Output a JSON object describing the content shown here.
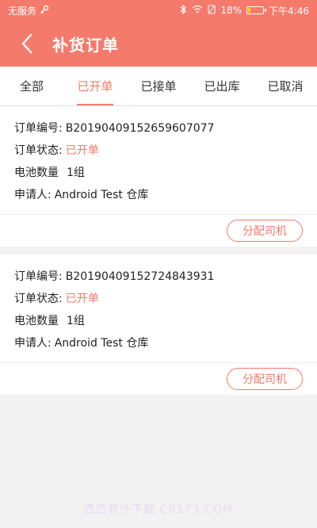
{
  "statusbar": {
    "carrier": "无服务",
    "battery_text": "18%",
    "battery_level": 0.18,
    "time": "下午4:46"
  },
  "header": {
    "title": "补货订单"
  },
  "tabs": [
    {
      "label": "全部"
    },
    {
      "label": "已开单"
    },
    {
      "label": "已接单"
    },
    {
      "label": "已出库"
    },
    {
      "label": "已取消"
    }
  ],
  "orders": [
    {
      "order_no_label": "订单编号:",
      "order_no": "B20190409152659607077",
      "status_label": "订单状态:",
      "status": "已开单",
      "qty_label": "电池数量",
      "qty": "1组",
      "applicant_label": "申请人:",
      "applicant": "Android Test 仓库",
      "action": "分配司机"
    },
    {
      "order_no_label": "订单编号:",
      "order_no": "B20190409152724843931",
      "status_label": "订单状态:",
      "status": "已开单",
      "qty_label": "电池数量",
      "qty": "1组",
      "applicant_label": "申请人:",
      "applicant": "Android Test 仓库",
      "action": "分配司机"
    }
  ],
  "watermark": "西西软件下载 CR173.COM",
  "colors": {
    "accent": "#f47a6c",
    "background": "#f2f2f2"
  }
}
